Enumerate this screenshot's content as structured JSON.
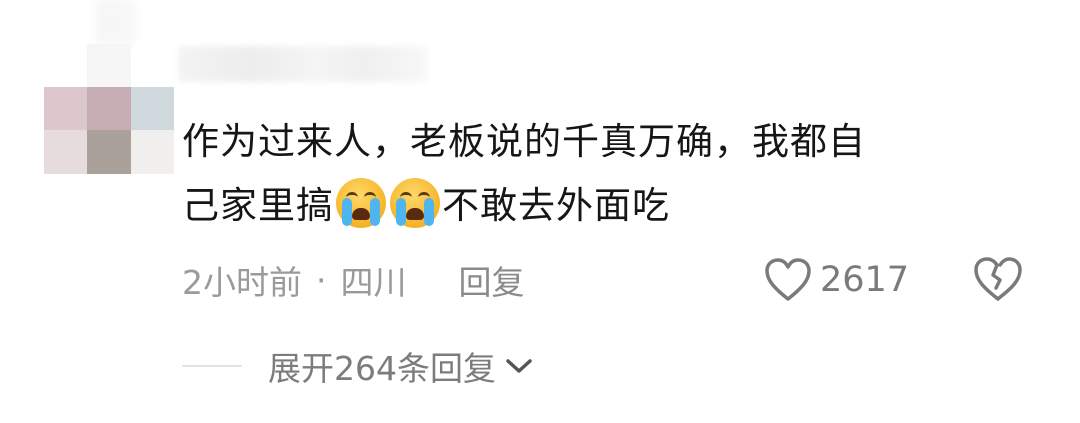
{
  "comment": {
    "text_line1": "作为过来人，老板说的千真万确，我都自",
    "text_line2_before": "己家里搞",
    "emoji_name": "loudly-crying-face",
    "text_line2_after": "不敢去外面吃"
  },
  "meta": {
    "time": "2小时前",
    "separator": "·",
    "location": "四川",
    "reply_label": "回复"
  },
  "actions": {
    "like_count": "2617",
    "like_icon": "heart-outline-icon",
    "dislike_icon": "broken-heart-icon"
  },
  "replies": {
    "expand_label": "展开264条回复"
  },
  "colors": {
    "text_primary": "#161616",
    "text_secondary": "#9a9a9a",
    "icon": "#7a7a7a"
  }
}
